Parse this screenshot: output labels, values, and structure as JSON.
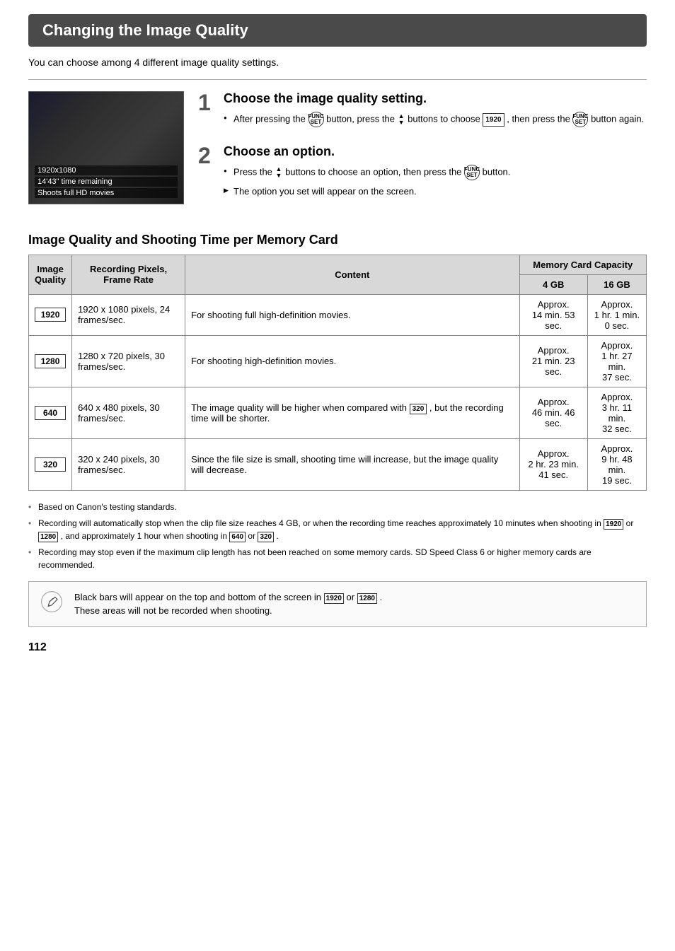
{
  "page": {
    "title": "Changing the Image Quality",
    "subtitle": "You can choose among 4 different image quality settings.",
    "page_number": "112"
  },
  "camera_image": {
    "resolution": "1920",
    "resolution_text": "1920x1080",
    "time_remaining": "14'43\" time remaining",
    "shoots_text": "Shoots full HD movies"
  },
  "steps": [
    {
      "number": "1",
      "title": "Choose the image quality setting.",
      "bullets": [
        {
          "type": "bullet",
          "text": "After pressing the  button, press the ▲▼ buttons to choose  , then press the  button again."
        }
      ]
    },
    {
      "number": "2",
      "title": "Choose an option.",
      "bullets": [
        {
          "type": "bullet",
          "text": "Press the ▲▼ buttons to choose an option, then press the  button."
        },
        {
          "type": "arrow",
          "text": "The option you set will appear on the screen."
        }
      ]
    }
  ],
  "table_section": {
    "title": "Image Quality and Shooting Time per Memory Card",
    "headers": {
      "image_quality": "Image\nQuality",
      "recording_pixels": "Recording Pixels,\nFrame Rate",
      "content": "Content",
      "memory_card_capacity": "Memory Card Capacity",
      "four_gb": "4 GB",
      "sixteen_gb": "16 GB"
    },
    "rows": [
      {
        "icon": "1920",
        "recording": "1920 x 1080 pixels, 24 frames/sec.",
        "content": "For shooting full high-definition movies.",
        "four_gb": "Approx.\n14 min. 53 sec.",
        "sixteen_gb": "Approx.\n1 hr. 1 min.\n0 sec."
      },
      {
        "icon": "1280",
        "recording": "1280 x 720 pixels, 30 frames/sec.",
        "content": "For shooting high-definition movies.",
        "four_gb": "Approx.\n21 min. 23 sec.",
        "sixteen_gb": "Approx.\n1 hr. 27 min.\n37 sec."
      },
      {
        "icon": "640",
        "recording": "640 x 480 pixels, 30 frames/sec.",
        "content": "The image quality will be higher when compared with , but the recording time will be shorter.",
        "four_gb": "Approx.\n46 min. 46 sec.",
        "sixteen_gb": "Approx.\n3 hr. 11 min.\n32 sec."
      },
      {
        "icon": "320",
        "recording": "320 x 240 pixels, 30 frames/sec.",
        "content": "Since the file size is small, shooting time will increase, but the image quality will decrease.",
        "four_gb": "Approx.\n2 hr. 23 min.\n41 sec.",
        "sixteen_gb": "Approx.\n9 hr. 48 min.\n19 sec."
      }
    ]
  },
  "notes": [
    "Based on Canon's testing standards.",
    "Recording will automatically stop when the clip file size reaches 4 GB, or when the recording time reaches approximately 10 minutes when shooting in  or  , and approximately 1 hour when shooting in  or  .",
    "Recording may stop even if the maximum clip length has not been reached on some memory cards. SD Speed Class 6 or higher memory cards are recommended."
  ],
  "info_box": {
    "text": "Black bars will appear on the top and bottom of the screen in  or  .\nThese areas will not be recorded when shooting."
  }
}
